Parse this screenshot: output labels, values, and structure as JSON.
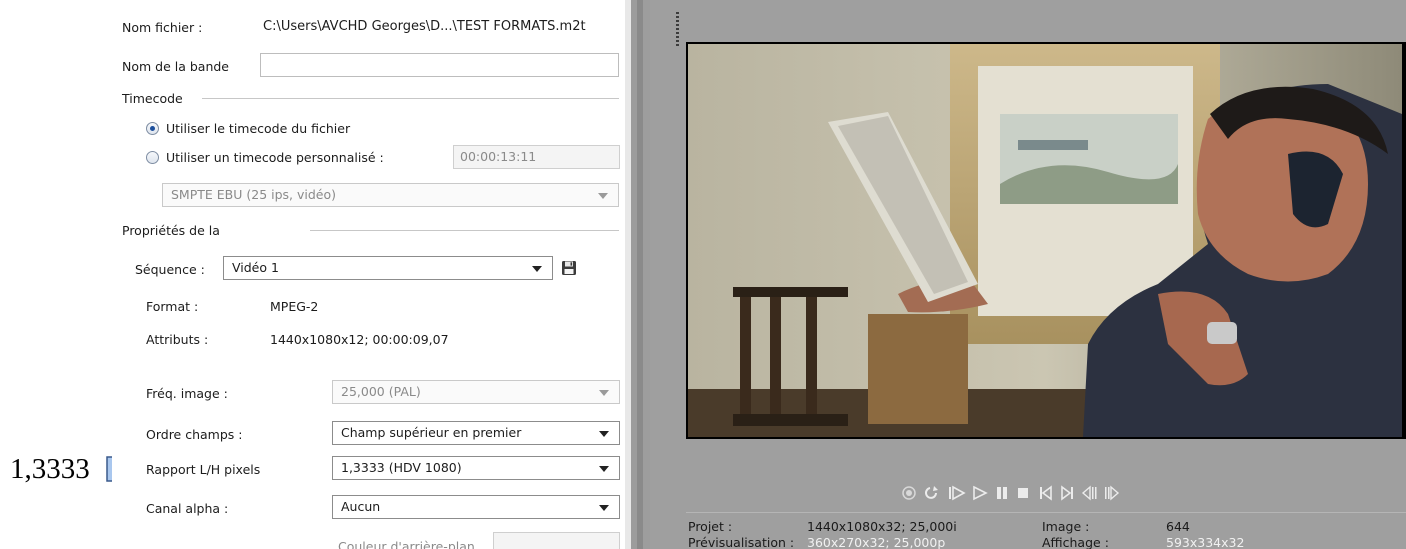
{
  "callout": {
    "value": "1,3333"
  },
  "file": {
    "name_label": "Nom fichier :",
    "name_value": "C:\\Users\\AVCHD Georges\\D...\\TEST FORMATS.m2t"
  },
  "tape": {
    "label": "Nom de la bande",
    "value": ""
  },
  "timecode": {
    "section_label": "Timecode",
    "use_file_label": "Utiliser le timecode du fichier",
    "use_custom_label": "Utiliser un timecode personnalisé :",
    "custom_value": "00:00:13:11",
    "format_value": "SMPTE EBU (25 ips, vidéo)"
  },
  "properties": {
    "section_label": "Propriétés de la",
    "sequence_label": "Séquence :",
    "sequence_value": "Vidéo 1",
    "format_label": "Format :",
    "format_value": "MPEG-2",
    "attributes_label": "Attributs :",
    "attributes_value": "1440x1080x12; 00:00:09,07",
    "frame_rate_label": "Fréq. image :",
    "frame_rate_value": "25,000 (PAL)",
    "field_order_label": "Ordre champs :",
    "field_order_value": "Champ supérieur en premier",
    "pixel_ratio_label": "Rapport L/H pixels",
    "pixel_ratio_value": "1,3333 (HDV 1080)",
    "alpha_label": "Canal alpha :",
    "alpha_value": "Aucun",
    "bg_color_label": "Couleur d'arrière-plan"
  },
  "preview": {
    "project_label": "Projet :",
    "project_value": "1440x1080x32; 25,000i",
    "preview_label": "Prévisualisation :",
    "preview_value": "360x270x32; 25,000p",
    "image_label": "Image :",
    "image_value": "644",
    "display_label": "Affichage :",
    "display_value": "593x334x32"
  },
  "colors": {
    "accent": "#1d4f9c",
    "callout_arrow": "#a9c7ee",
    "preview_bg": "#9f9f9f"
  }
}
